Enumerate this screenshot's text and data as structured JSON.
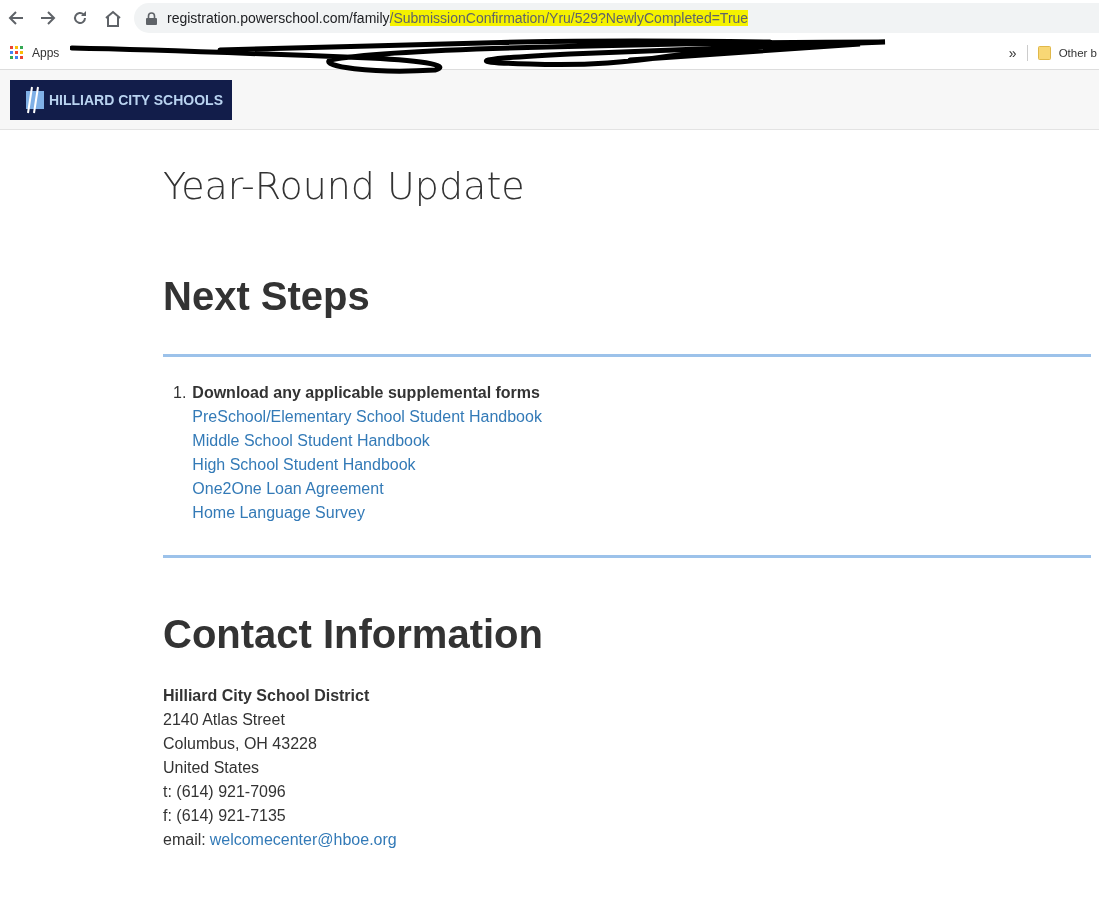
{
  "browser": {
    "url_parts": [
      {
        "text": "registration.powerschool.com/family",
        "highlighted": false
      },
      {
        "text": "/SubmissionConfirmation/Yru/529?NewlyCompleted=True",
        "highlighted": true
      }
    ],
    "bookmarks": [
      {
        "kind": "apps",
        "label": "Apps"
      },
      {
        "kind": "more",
        "label": "»"
      },
      {
        "kind": "folder",
        "label": "Other b"
      }
    ]
  },
  "header": {
    "logo_text": "HILLIARD CITY SCHOOLS"
  },
  "page": {
    "title": "Year-Round Update",
    "next_steps": {
      "heading": "Next Steps",
      "items": [
        {
          "number": "1.",
          "title": "Download any applicable supplemental forms",
          "links": [
            "PreSchool/Elementary School Student Handbook",
            "Middle School Student Handbook",
            "High School Student Handbook",
            "One2One Loan Agreement",
            "Home Language Survey"
          ]
        }
      ]
    },
    "contact": {
      "heading": "Contact Information",
      "name": "Hilliard City School District",
      "lines": [
        "2140 Atlas Street",
        "Columbus, OH 43228",
        "United States",
        "t: (614) 921-7096",
        "f: (614) 921-7135"
      ],
      "email_label": "email:",
      "email": "welcomecenter@hboe.org"
    }
  }
}
